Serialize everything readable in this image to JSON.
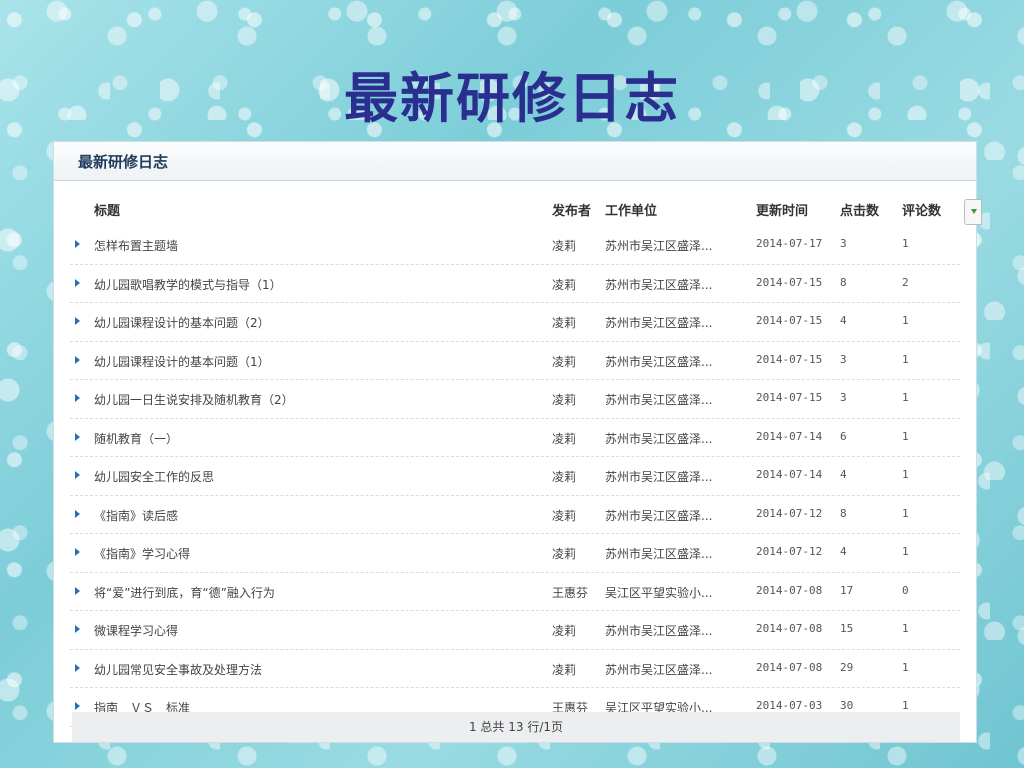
{
  "slide": {
    "title": "最新研修日志"
  },
  "panel": {
    "title": "最新研修日志"
  },
  "table": {
    "headers": {
      "title": "标题",
      "author": "发布者",
      "unit": "工作单位",
      "time": "更新时间",
      "clicks": "点击数",
      "comments": "评论数"
    },
    "rows": [
      {
        "title": "怎样布置主题墙",
        "author": "凌莉",
        "unit": "苏州市吴江区盛泽...",
        "time": "2014-07-17",
        "clicks": "3",
        "comments": "1"
      },
      {
        "title": "幼儿园歌唱教学的模式与指导（1）",
        "author": "凌莉",
        "unit": "苏州市吴江区盛泽...",
        "time": "2014-07-15",
        "clicks": "8",
        "comments": "2"
      },
      {
        "title": "幼儿园课程设计的基本问题（2）",
        "author": "凌莉",
        "unit": "苏州市吴江区盛泽...",
        "time": "2014-07-15",
        "clicks": "4",
        "comments": "1"
      },
      {
        "title": "幼儿园课程设计的基本问题（1）",
        "author": "凌莉",
        "unit": "苏州市吴江区盛泽...",
        "time": "2014-07-15",
        "clicks": "3",
        "comments": "1"
      },
      {
        "title": "幼儿园一日生说安排及随机教育（2）",
        "author": "凌莉",
        "unit": "苏州市吴江区盛泽...",
        "time": "2014-07-15",
        "clicks": "3",
        "comments": "1"
      },
      {
        "title": "随机教育（一）",
        "author": "凌莉",
        "unit": "苏州市吴江区盛泽...",
        "time": "2014-07-14",
        "clicks": "6",
        "comments": "1"
      },
      {
        "title": "幼儿园安全工作的反思",
        "author": "凌莉",
        "unit": "苏州市吴江区盛泽...",
        "time": "2014-07-14",
        "clicks": "4",
        "comments": "1"
      },
      {
        "title": "《指南》读后感",
        "author": "凌莉",
        "unit": "苏州市吴江区盛泽...",
        "time": "2014-07-12",
        "clicks": "8",
        "comments": "1"
      },
      {
        "title": "《指南》学习心得",
        "author": "凌莉",
        "unit": "苏州市吴江区盛泽...",
        "time": "2014-07-12",
        "clicks": "4",
        "comments": "1"
      },
      {
        "title": "将“爱”进行到底，育“德”融入行为",
        "author": "王惠芬",
        "unit": "吴江区平望实验小...",
        "time": "2014-07-08",
        "clicks": "17",
        "comments": "0"
      },
      {
        "title": "微课程学习心得",
        "author": "凌莉",
        "unit": "苏州市吴江区盛泽...",
        "time": "2014-07-08",
        "clicks": "15",
        "comments": "1"
      },
      {
        "title": "幼儿园常见安全事故及处理方法",
        "author": "凌莉",
        "unit": "苏州市吴江区盛泽...",
        "time": "2014-07-08",
        "clicks": "29",
        "comments": "1"
      },
      {
        "title": "指南　ＶＳ　标准",
        "author": "王惠芬",
        "unit": "吴江区平望实验小...",
        "time": "2014-07-03",
        "clicks": "30",
        "comments": "1"
      }
    ],
    "footer": "1 总共 13 行/1页"
  },
  "icons": {
    "row_bullet": "triangle-right-icon",
    "side_tab": "chevron-down-icon"
  },
  "colors": {
    "title": "#2a2f8f",
    "bullet": "#2a6fb0",
    "background": "#8fd6df"
  }
}
